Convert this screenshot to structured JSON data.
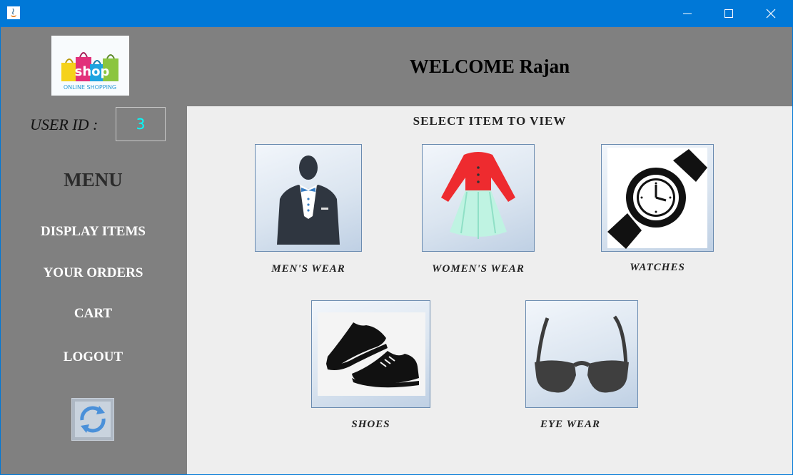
{
  "window": {
    "minimize_icon": "minimize-icon",
    "maximize_icon": "maximize-icon",
    "close_icon": "close-icon"
  },
  "header": {
    "welcome": "WELCOME Rajan"
  },
  "logo": {
    "text": "shop",
    "subtitle": "ONLINE SHOPPING"
  },
  "user": {
    "label": "USER ID :",
    "id": "3"
  },
  "menu": {
    "title": "MENU",
    "items": [
      {
        "label": "DISPLAY ITEMS"
      },
      {
        "label": "YOUR ORDERS"
      },
      {
        "label": "CART"
      },
      {
        "label": "LOGOUT"
      }
    ],
    "refresh_icon": "refresh-icon"
  },
  "main": {
    "title": "SELECT ITEM TO VIEW",
    "categories": [
      {
        "label": "MEN'S WEAR",
        "icon": "suit-icon"
      },
      {
        "label": "WOMEN'S WEAR",
        "icon": "dress-icon"
      },
      {
        "label": "WATCHES",
        "icon": "watch-icon"
      },
      {
        "label": "SHOES",
        "icon": "shoes-icon"
      },
      {
        "label": "EYE WEAR",
        "icon": "sunglasses-icon"
      }
    ]
  },
  "colors": {
    "titlebar": "#0078d7",
    "sidebar": "#808080",
    "content": "#eeeeee",
    "user_id_text": "#00ffff"
  }
}
